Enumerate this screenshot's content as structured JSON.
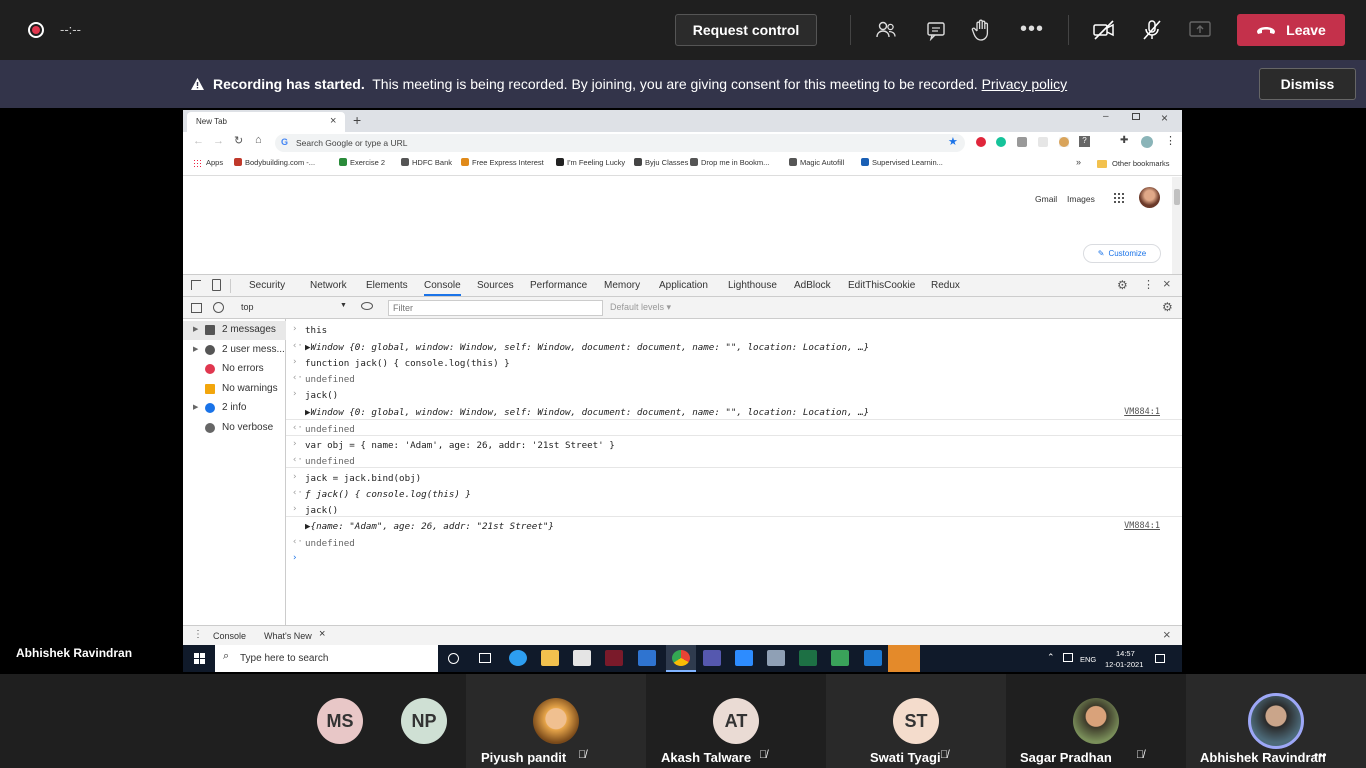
{
  "meeting": {
    "timer": "--:--",
    "request_control": "Request control",
    "leave": "Leave",
    "colors": {
      "leave": "#c4314b",
      "record_dot": "#e0374f"
    }
  },
  "banner": {
    "title": "Recording has started.",
    "message": "This meeting is being recorded. By joining, you are giving consent for this meeting to be recorded.",
    "link": "Privacy policy",
    "dismiss": "Dismiss"
  },
  "presenter_name": "Abhishek Ravindran",
  "browser": {
    "tab_title": "New Tab",
    "omnibox_placeholder": "Search Google or type a URL",
    "bookmarks": [
      "Apps",
      "Bodybuilding.com -...",
      "Exercise 2",
      "HDFC Bank",
      "Free Express Interest",
      "I'm Feeling Lucky",
      "Byju Classes",
      "Drop me in Bookm...",
      "Magic Autofill",
      "Supervised Learnin..."
    ],
    "bookmarks_more": "»",
    "other_bookmarks": "Other bookmarks",
    "page_links": {
      "gmail": "Gmail",
      "images": "Images",
      "customize": "Customize"
    }
  },
  "devtools": {
    "tabs": [
      "Security",
      "Network",
      "Elements",
      "Console",
      "Sources",
      "Performance",
      "Memory",
      "Application",
      "Lighthouse",
      "AdBlock",
      "EditThisCookie",
      "Redux"
    ],
    "active_tab": "Console",
    "context": "top",
    "filter_placeholder": "Filter",
    "levels": "Default levels ▾",
    "sidebar": [
      {
        "label": "2 messages",
        "icon": "list-icon",
        "arrow": true
      },
      {
        "label": "2 user mess...",
        "icon": "user-icon",
        "arrow": true
      },
      {
        "label": "No errors",
        "icon": "error-icon",
        "arrow": false
      },
      {
        "label": "No warnings",
        "icon": "warning-icon",
        "arrow": false
      },
      {
        "label": "2 info",
        "icon": "info-icon",
        "arrow": true
      },
      {
        "label": "No verbose",
        "icon": "gear-icon",
        "arrow": false
      }
    ],
    "console_lines": [
      {
        "kind": "input",
        "text": "this"
      },
      {
        "kind": "output",
        "text": "▶Window {0: global, window: Window, self: Window, document: document, name: \"\", location: Location, …}",
        "italic": true
      },
      {
        "kind": "input",
        "text": "function jack() { console.log(this) }"
      },
      {
        "kind": "result",
        "text": "undefined"
      },
      {
        "kind": "input",
        "text": "jack()"
      },
      {
        "kind": "log",
        "text": "▶Window {0: global, window: Window, self: Window, document: document, name: \"\", location: Location, …}",
        "ref": "VM884:1",
        "italic": true
      },
      {
        "kind": "result",
        "text": "undefined"
      },
      {
        "kind": "input",
        "text": "var obj = { name: 'Adam', age: 26, addr: '21st Street' }"
      },
      {
        "kind": "result",
        "text": "undefined"
      },
      {
        "kind": "input",
        "text": "jack = jack.bind(obj)"
      },
      {
        "kind": "output",
        "text": "ƒ jack() { console.log(this) }",
        "italic": true
      },
      {
        "kind": "input",
        "text": "jack()"
      },
      {
        "kind": "log",
        "text": "▶{name: \"Adam\", age: 26, addr: \"21st Street\"}",
        "ref": "VM884:1",
        "italic": true
      },
      {
        "kind": "result",
        "text": "undefined"
      },
      {
        "kind": "prompt",
        "text": ""
      }
    ],
    "drawer_tabs": [
      "Console",
      "What's New"
    ]
  },
  "taskbar": {
    "search_placeholder": "Type here to search",
    "lang": "ENG",
    "time": "14:57",
    "date": "12-01-2021"
  },
  "participants": [
    {
      "initials": "MS",
      "name": "",
      "color": "#e8c7c7"
    },
    {
      "initials": "NP",
      "name": "",
      "color": "#cfe0d4"
    },
    {
      "initials": "",
      "name": "Piyush pandit",
      "color": "#e8a64a"
    },
    {
      "initials": "AT",
      "name": "Akash Talware",
      "color": "#eadbd4"
    },
    {
      "initials": "ST",
      "name": "Swati Tyagi",
      "color": "#f4dccc"
    },
    {
      "initials": "",
      "name": "Sagar Pradhan",
      "color": "#7a8f5a"
    },
    {
      "initials": "",
      "name": "Abhishek Ravindran",
      "color": "#4d6b7a"
    }
  ]
}
